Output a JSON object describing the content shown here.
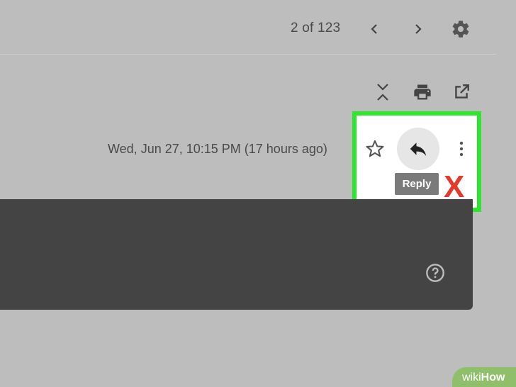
{
  "header": {
    "page_count": "2 of 123",
    "prev_icon": "chevron-left-icon",
    "next_icon": "chevron-right-icon",
    "settings_icon": "gear-icon"
  },
  "toolbar": {
    "collapse_icon": "collapse-all-icon",
    "print_icon": "print-icon",
    "new_window_icon": "open-in-new-window-icon"
  },
  "message": {
    "date": "Wed, Jun 27, 10:15 PM (17 hours ago)",
    "star_icon": "star-outline-icon",
    "reply_icon": "reply-arrow-icon",
    "more_icon": "more-vertical-icon",
    "reply_tooltip": "Reply"
  },
  "annotation": {
    "mark": "X",
    "highlight_color": "#2ee62e",
    "mark_color": "#e23b2b"
  },
  "panel": {
    "help_icon": "help-circle-icon"
  },
  "watermark": {
    "prefix": "wiki",
    "brand": "How"
  }
}
